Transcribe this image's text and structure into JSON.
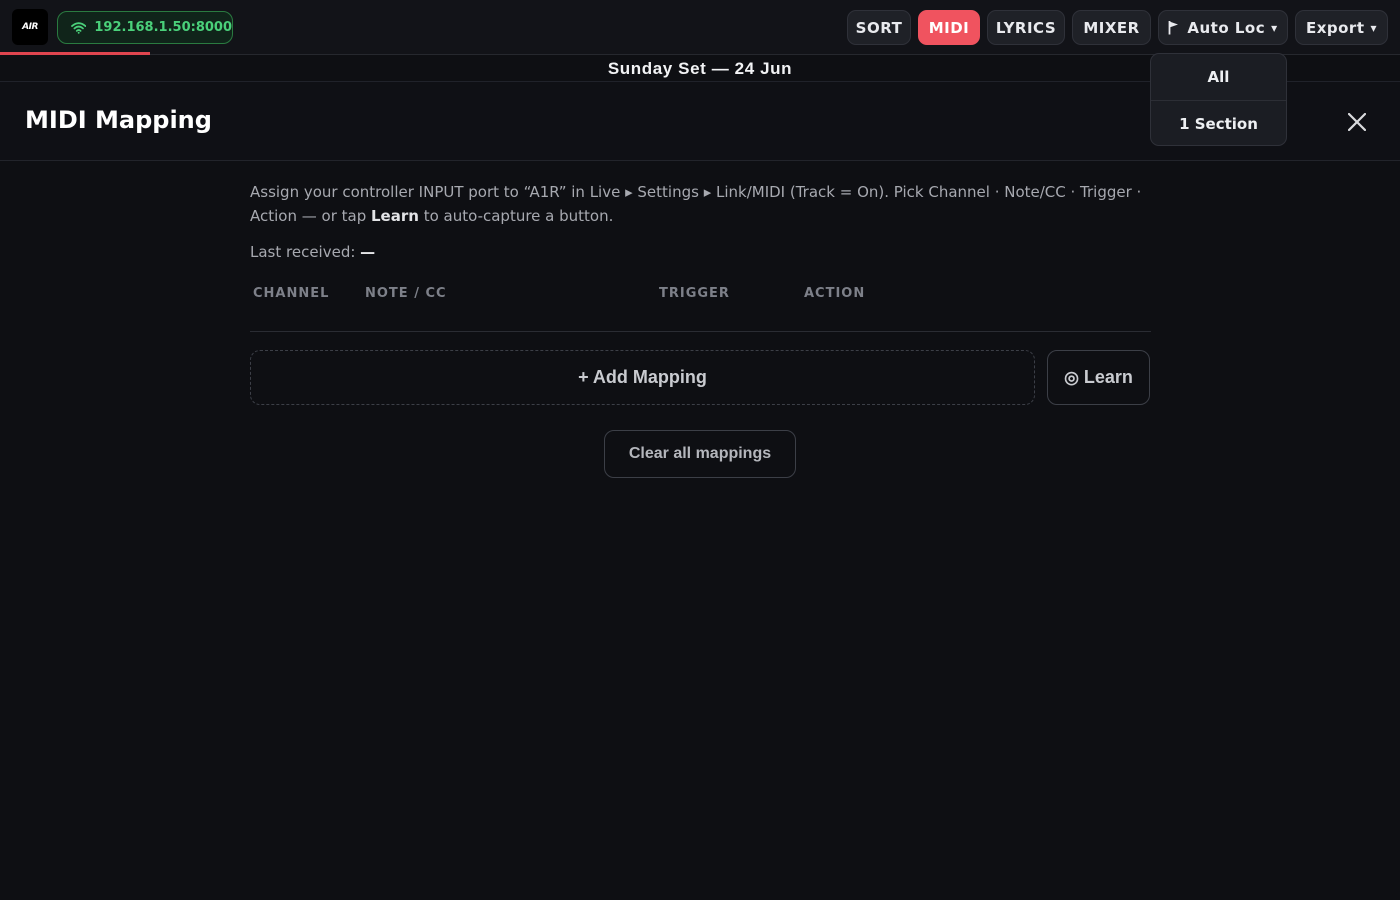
{
  "app": {
    "logo_text": "AIR"
  },
  "connection": {
    "icon": "wifi-icon",
    "address": "192.168.1.50:8000",
    "color": "#4ad07a"
  },
  "toolbar": {
    "sort_label": "SORT",
    "midi_label": "MIDI",
    "lyrics_label": "LYRICS",
    "mixer_label": "MIXER",
    "autoloc_label": "Auto Loc",
    "autoloc_icon": "flag-icon",
    "export_label": "Export",
    "caret": "▾",
    "active_color": "#f0535f"
  },
  "set_title": "Sunday Set — 24 Jun",
  "dropdown": {
    "items": [
      {
        "label": "All"
      },
      {
        "label": "1 Section"
      }
    ]
  },
  "modal": {
    "title": "MIDI Mapping",
    "close_icon": "close-icon",
    "description_part1": "Assign your controller INPUT port to “A1R” in Live ▸ Settings ▸ Link/MIDI (Track = On). Pick Channel · Note/CC · Trigger · Action — or tap ",
    "description_bold": "Learn",
    "description_part2": " to auto-capture a button.",
    "last_received_label": "Last received: ",
    "last_received_value": "—",
    "columns": [
      "CHANNEL",
      "NOTE / CC",
      "TRIGGER",
      "ACTION"
    ],
    "add_mapping_label": "+ Add Mapping",
    "learn_icon": "◎",
    "learn_label": "Learn",
    "clear_all_label": "Clear all mappings"
  }
}
